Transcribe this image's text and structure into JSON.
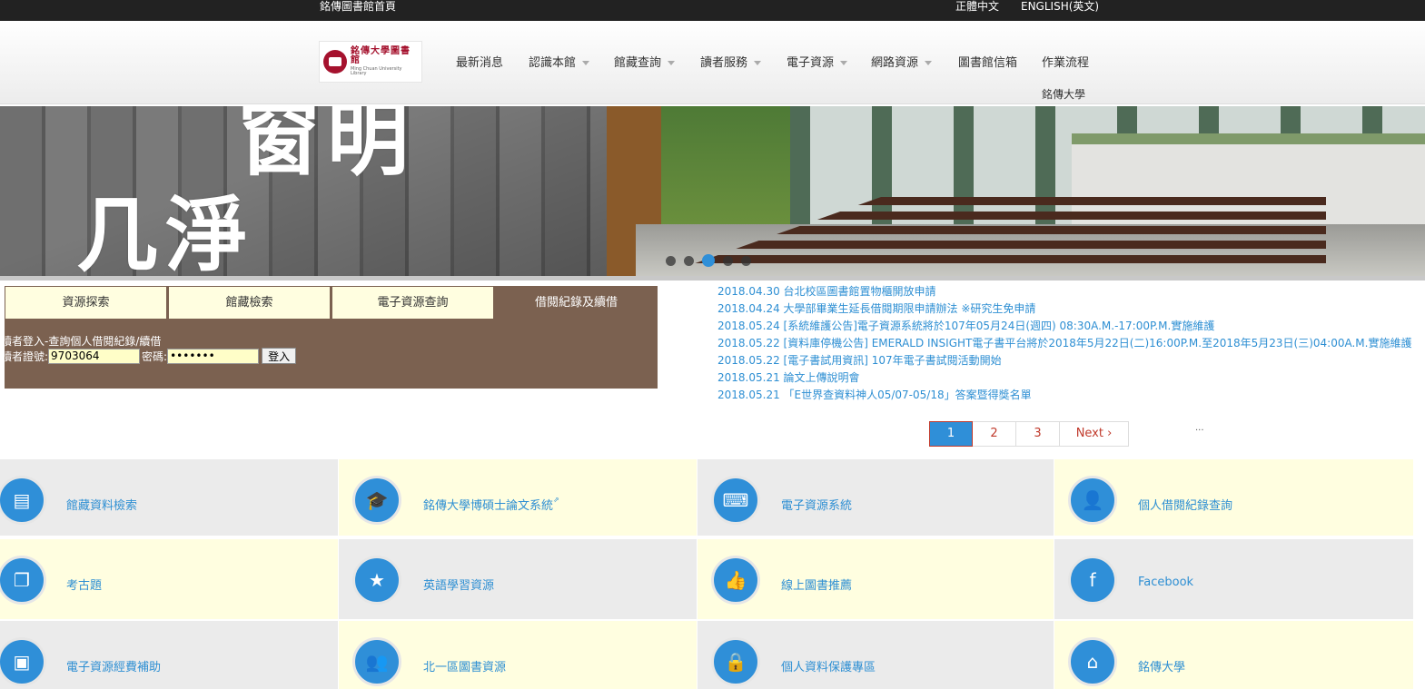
{
  "topbar": {
    "home_link": "銘傳圖書館首頁",
    "lang_zh": "正體中文",
    "lang_en": "ENGLISH(英文)"
  },
  "logo": {
    "zh": "銘傳大學圖書館",
    "en": "Ming Chuan University Library"
  },
  "nav": {
    "items": [
      {
        "label": "最新消息",
        "dropdown": false
      },
      {
        "label": "認識本館",
        "dropdown": true
      },
      {
        "label": "館藏查詢",
        "dropdown": true
      },
      {
        "label": "讀者服務",
        "dropdown": true
      },
      {
        "label": "電子資源",
        "dropdown": true
      },
      {
        "label": "網路資源",
        "dropdown": true
      },
      {
        "label": "圖書館信箱",
        "dropdown": false
      },
      {
        "label": "作業流程",
        "dropdown": false
      }
    ],
    "second_row": "銘傳大學"
  },
  "banner": {
    "text_line1": "窗明",
    "text_line2": "几淨",
    "slide_count": 5,
    "active_slide": 3
  },
  "search": {
    "tabs": [
      "資源探索",
      "館藏檢索",
      "電子資源查詢",
      "借閱紀錄及續借"
    ],
    "active_tab": 3,
    "login_heading": "讀者登入-查詢個人借閱紀錄/續借",
    "account_label": "讀者證號:",
    "account_value": "9703064",
    "password_label": "密碼:",
    "password_value": "•••••••",
    "login_button": "登入"
  },
  "news": [
    "2018.04.30 台北校區圖書館置物櫃開放申請",
    "2018.04.24 大學部畢業生延長借閱期限申請辦法 ※研究生免申請",
    "2018.05.24 [系統維護公告]電子資源系統將於107年05月24日(週四) 08:30A.M.-17:00P.M.實施維護",
    "2018.05.22 [資料庫停機公告] EMERALD INSIGHT電子書平台將於2018年5月22日(二)16:00P.M.至2018年5月23日(三)04:00A.M.實施維護",
    "2018.05.22 [電子書試用資訊] 107年電子書試閱活動開始",
    "2018.05.21 論文上傳說明會",
    "2018.05.21 「E世界查資料神人05/07-05/18」答案暨得獎名單"
  ],
  "pager": {
    "pages": [
      "1",
      "2",
      "3"
    ],
    "active": "1",
    "next": "Next ›",
    "ellipsis": "..."
  },
  "tiles": [
    {
      "label": "館藏資料檢索",
      "icon": "book-icon",
      "glyph": "▤"
    },
    {
      "label": "銘傳大學博碩士論文系統",
      "icon": "graduation-cap-icon",
      "glyph": "🎓",
      "external": true
    },
    {
      "label": "電子資源系統",
      "icon": "keyboard-icon",
      "glyph": "⌨"
    },
    {
      "label": "個人借閱紀錄查詢",
      "icon": "user-icon",
      "glyph": "👤"
    },
    {
      "label": "考古題",
      "icon": "copy-icon",
      "glyph": "❐"
    },
    {
      "label": "英語學習資源",
      "icon": "star-icon",
      "glyph": "★"
    },
    {
      "label": "線上圖書推薦",
      "icon": "thumbs-up-icon",
      "glyph": "👍"
    },
    {
      "label": "Facebook",
      "icon": "facebook-icon",
      "glyph": "f"
    },
    {
      "label": "電子資源經費補助",
      "icon": "money-icon",
      "glyph": "▣"
    },
    {
      "label": "北一區圖書資源",
      "icon": "users-icon",
      "glyph": "👥"
    },
    {
      "label": "個人資料保護專區",
      "icon": "lock-icon",
      "glyph": "🔒"
    },
    {
      "label": "銘傳大學",
      "icon": "home-icon",
      "glyph": "⌂"
    }
  ],
  "colors": {
    "accent_blue": "#2f8fd8",
    "link_blue": "#2e8fd3",
    "search_brown": "#7b6150",
    "tab_cream": "#fffee0",
    "topbar": "#222222"
  }
}
